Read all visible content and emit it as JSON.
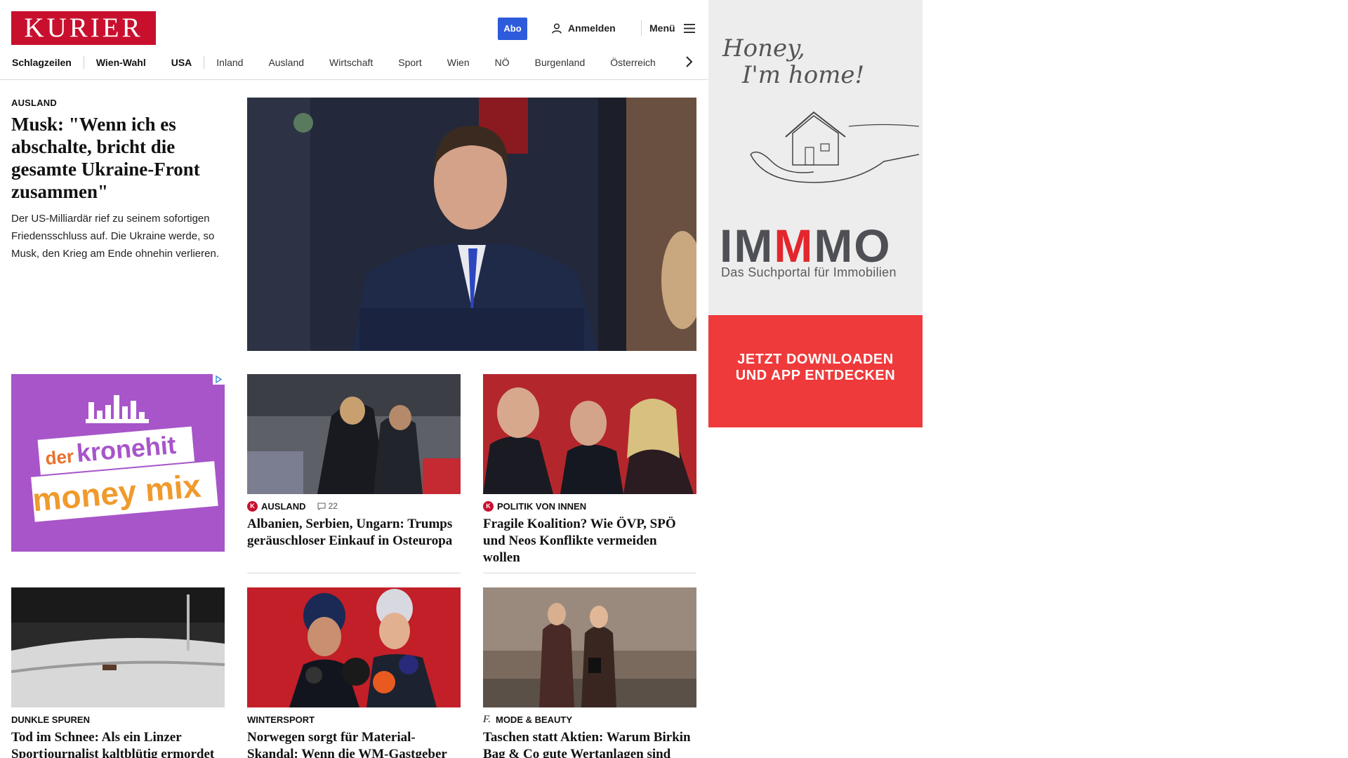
{
  "header": {
    "logo": "KURIER",
    "abo_label": "Abo",
    "login_label": "Anmelden",
    "menu_label": "Menü"
  },
  "nav": {
    "items": [
      "Schlagzeilen",
      "Wien-Wahl",
      "USA",
      "Inland",
      "Ausland",
      "Wirtschaft",
      "Sport",
      "Wien",
      "NÖ",
      "Burgenland",
      "Österreich"
    ]
  },
  "lead": {
    "kicker": "AUSLAND",
    "title": "Musk: \"Wenn ich es abschalte, bricht die gesamte Ukraine-Front zusammen\"",
    "teaser": "Der US-Milliardär rief zu seinem sofortigen Friedensschluss auf. Die Ukraine werde, so Musk, den Krieg am Ende ohnehin verlieren."
  },
  "ad_left": {
    "line1": "der",
    "line2": "kronehit",
    "line3": "money mix"
  },
  "cards": [
    {
      "kicker": "AUSLAND",
      "comments": "22",
      "title": "Albanien, Serbien, Ungarn: Trumps geräuschloser Einkauf in Osteuropa"
    },
    {
      "kicker": "POLITIK VON INNEN",
      "title": "Fragile Koalition? Wie ÖVP, SPÖ und Neos Konflikte vermeiden wollen"
    },
    {
      "kicker": "DUNKLE SPUREN",
      "title": "Tod im Schnee: Als ein Linzer Sportjournalist kaltblütig ermordet wurde"
    },
    {
      "kicker": "WINTERSPORT",
      "title": "Norwegen sorgt für Material-Skandal: Wenn die WM-Gastgeber betrügen"
    },
    {
      "kicker": "MODE & BEAUTY",
      "title": "Taschen statt Aktien: Warum Birkin Bag & Co gute Wertanlagen sind"
    }
  ],
  "side_ad": {
    "tagline_1": "Honey,",
    "tagline_2": "I'm home!",
    "brand": "IMMMO",
    "brand_sub": "Das Suchportal für Immobilien",
    "cta_line1": "JETZT DOWNLOADEN",
    "cta_line2": "UND APP ENTDECKEN"
  },
  "colors": {
    "brand_red": "#c8102e",
    "abo_blue": "#2e5bdb",
    "ad_purple": "#a755c9",
    "cta_red": "#ef3a3b"
  }
}
